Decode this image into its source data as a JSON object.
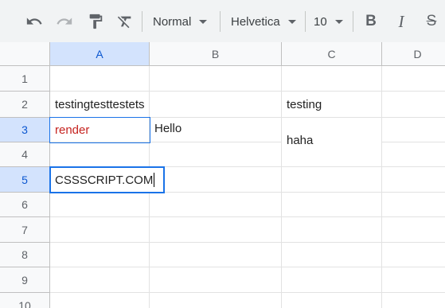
{
  "toolbar": {
    "undo_icon": "undo-icon",
    "redo_icon": "redo-icon",
    "paint_format_icon": "paint-format-icon",
    "clear_format_icon": "clear-format-icon",
    "style_select": "Normal",
    "font_select": "Helvetica",
    "size_select": "10",
    "bold_label": "B",
    "italic_label": "I",
    "strike_label": "S"
  },
  "columns": [
    "A",
    "B",
    "C",
    "D"
  ],
  "rows": [
    "1",
    "2",
    "3",
    "4",
    "5",
    "6",
    "7",
    "8",
    "9",
    "10"
  ],
  "cells": {
    "A2": "testingtesttestets",
    "A3": "render",
    "B3": "Hello",
    "C2": "testing",
    "C3": "haha",
    "A5": "CSSSCRIPT.COM"
  },
  "selection": {
    "active_cell": "A5",
    "range": "A3"
  },
  "colors": {
    "accent": "#1a73e8",
    "header_selected": "#d3e3fd",
    "red_text": "#c5221f"
  }
}
